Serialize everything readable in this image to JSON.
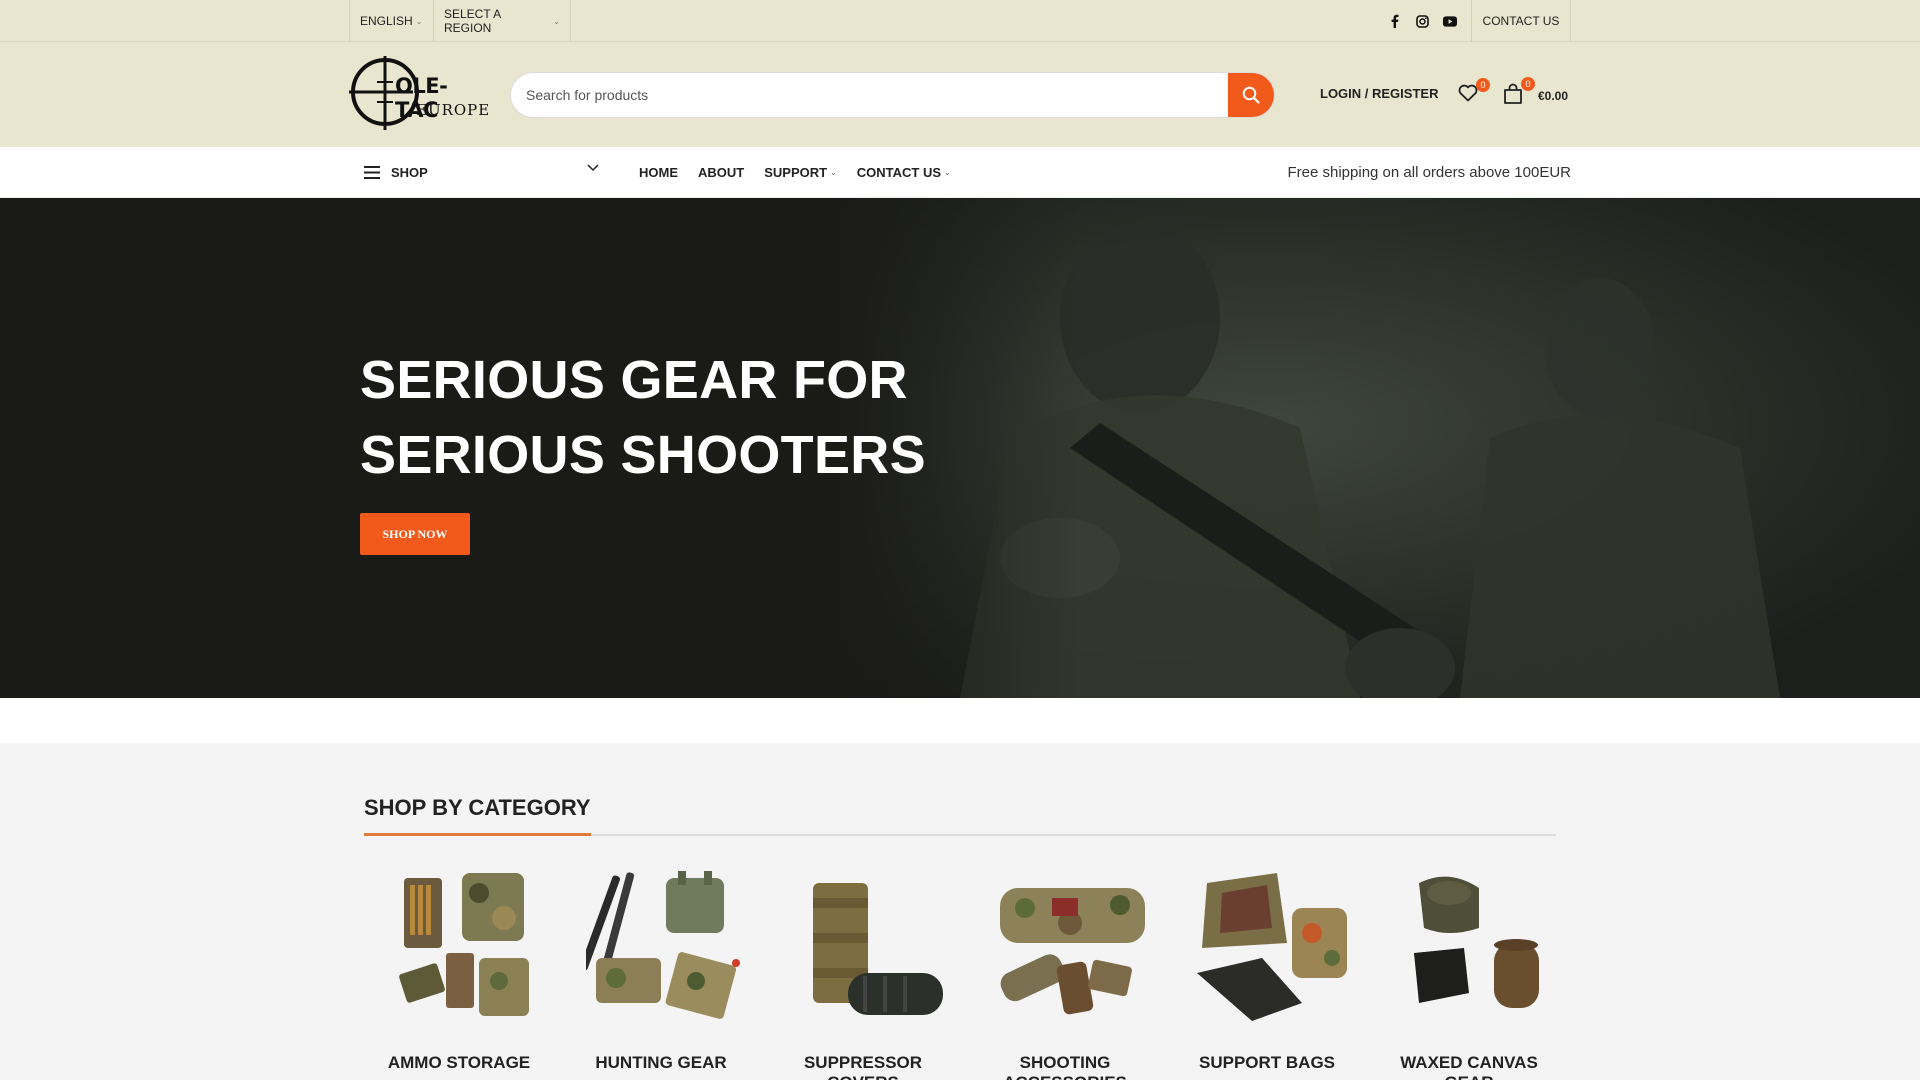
{
  "topbar": {
    "language": "ENGLISH",
    "region": "SELECT A REGION",
    "social": [
      "facebook-icon",
      "instagram-icon",
      "youtube-icon"
    ],
    "contact": "CONTACT US"
  },
  "header": {
    "logo_line1": "OLE-TAC",
    "logo_line2": "EUROPE",
    "search_placeholder": "Search for products",
    "login": "LOGIN / REGISTER",
    "wishlist_count": "0",
    "cart_count": "0",
    "cart_total": "€0.00"
  },
  "nav": {
    "shop": "SHOP",
    "links": [
      "HOME",
      "ABOUT",
      "SUPPORT",
      "CONTACT US"
    ],
    "shipping": "Free shipping on all orders above 100EUR"
  },
  "hero": {
    "title_line1": "SERIOUS GEAR FOR",
    "title_line2": "SERIOUS SHOOTERS",
    "cta": "SHOP NOW"
  },
  "categories": {
    "title": "SHOP BY CATEGORY",
    "items": [
      {
        "label": "AMMO STORAGE"
      },
      {
        "label": "HUNTING GEAR"
      },
      {
        "label": "SUPPRESSOR COVERS"
      },
      {
        "label": "SHOOTING ACCESSORIES"
      },
      {
        "label": "SUPPORT BAGS"
      },
      {
        "label": "WAXED CANVAS GEAR"
      }
    ]
  },
  "colors": {
    "accent": "#f15a1a",
    "header_bg": "#e8e6cf",
    "hero_bg": "#1a1a17"
  }
}
